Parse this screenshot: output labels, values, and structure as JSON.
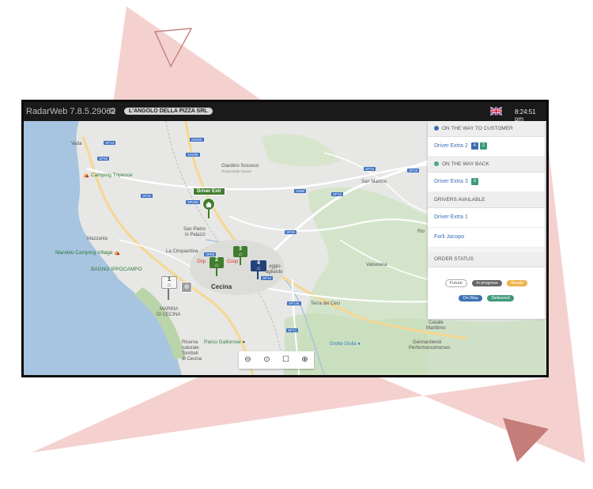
{
  "app": {
    "title": "RadarWeb 7.8.5.29062",
    "company": "L'ANGOLO DELLA PIZZA SRL",
    "clock": "8:24:51 pm",
    "settings_icon": "gear-icon",
    "language_icon": "uk-flag-icon"
  },
  "map": {
    "places": {
      "vada": "Vada",
      "camping_tripesce": "Camping Tripesce",
      "giardino": "Giardino Sosseso",
      "giardino_sub": "Temporarily closed",
      "san_martino": "San Martino",
      "san_pietro": "San Pietro",
      "in_palazzi": "in Palazzi",
      "mazzanta": "Mazzanta",
      "mareblu": "Mareblu Camping Village",
      "la_cinquantina": "La Cinquantina",
      "bagno": "BAGNO IPPOCAMPO",
      "ospedale": "Osp",
      "cecina": "Cecina",
      "marina": "MARINA",
      "di_cecina": "DI CECINA",
      "terra_dei_ceci": "Terra dei Ceci",
      "valserena": "Valserena",
      "rio": "Rio",
      "riserva1": "Riserva",
      "riserva2": "naturale",
      "riserva3": "Tomboli",
      "riserva4": "di Cecina",
      "parco": "Parco Gallorose",
      "grotte": "Grotte Giulia",
      "casale1": "Casale",
      "casale2": "Marittimo",
      "gen1": "Gennarolendi",
      "gen2": "Performancehorses",
      "poggio1": "oggio",
      "poggio2": "agliardo",
      "coop": "Coop"
    },
    "roads": [
      "SP13",
      "SS206",
      "SP39",
      "SS206",
      "SP15",
      "SR206",
      "SS68",
      "SP15",
      "SP25",
      "SP29",
      "SR68",
      "SP14",
      "SP146",
      "SP14",
      "SP15"
    ],
    "markers": {
      "driver_label": "Driver Extr",
      "m3": "3",
      "m2": "2",
      "m4": "4",
      "m1": "1"
    },
    "colors": {
      "green_marker": "#3f7d2f",
      "blue_marker": "#24427a",
      "white_marker": "#f4f4f4"
    }
  },
  "panel": {
    "on_the_way_to_customer": "ON THE WAY TO CUSTOMER",
    "driver_extra_2": "Driver Extra 2",
    "badge_4": "4",
    "badge_2": "2",
    "on_the_way_back": "ON THE WAY BACK",
    "driver_extra_3": "Driver Extra 3",
    "badge_3": "3",
    "drivers_available": "DRIVERS AVAILABLE",
    "driver_extra_1": "Driver Extra 1",
    "forli_jacopo": "Forli Jacopo",
    "order_status": "ORDER STATUS",
    "status": {
      "future": "Future",
      "in_progress": "In progress",
      "ready": "Ready",
      "on_way": "On Way",
      "delivered": "Delivered"
    },
    "colors": {
      "to_customer_dot": "#3a6fb3",
      "way_back_dot": "#4aaa7c",
      "badge_blue": "#3a6fb3",
      "badge_green": "#3f9a7a"
    }
  },
  "zoom": {
    "zoom_out_icon": "zoom-out-icon",
    "center_icon": "target-icon",
    "fit_icon": "square-icon",
    "zoom_in_icon": "zoom-in-icon"
  }
}
